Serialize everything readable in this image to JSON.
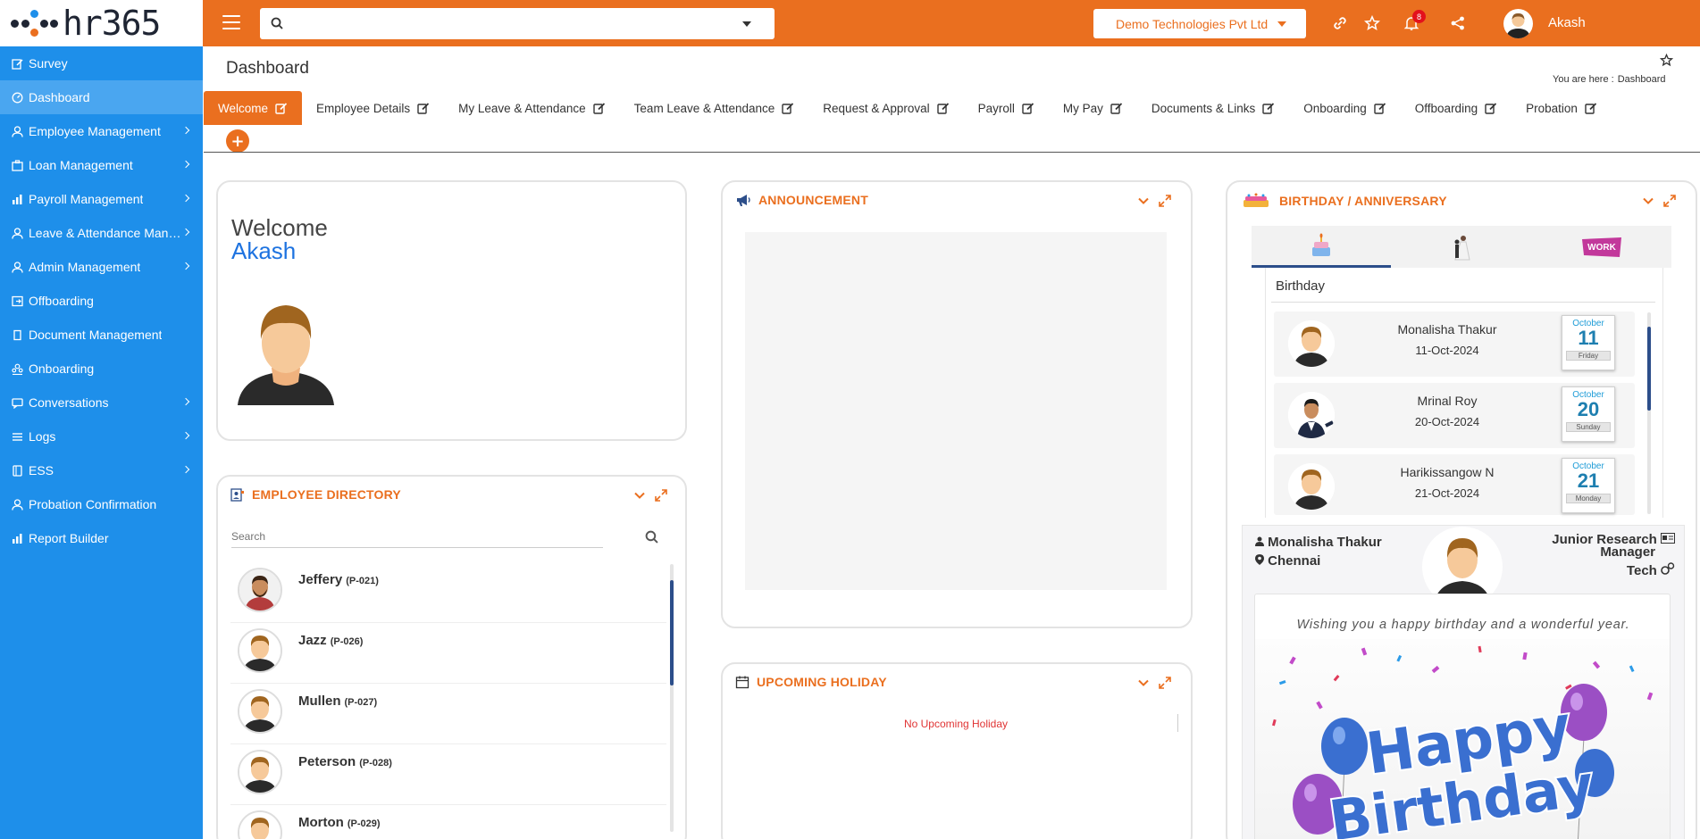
{
  "brand": {
    "logo_text": "hr365",
    "orange": "#ea6f1f",
    "blue": "#1e8fea"
  },
  "topbar": {
    "search_value": "",
    "company": "Demo Technologies Pvt Ltd",
    "notification_count": "8",
    "user_name": "Akash",
    "icons": [
      "link-icon",
      "star-icon",
      "bell-icon",
      "share-icon"
    ]
  },
  "sidebar": {
    "items": [
      {
        "label": "Survey",
        "icon": "edit-icon",
        "has_submenu": false
      },
      {
        "label": "Dashboard",
        "icon": "dashboard-icon",
        "has_submenu": false
      },
      {
        "label": "Employee Management",
        "icon": "user-icon",
        "has_submenu": true
      },
      {
        "label": "Loan Management",
        "icon": "bank-icon",
        "has_submenu": true
      },
      {
        "label": "Payroll Management",
        "icon": "chart-icon",
        "has_submenu": true
      },
      {
        "label": "Leave & Attendance Management",
        "icon": "user-icon",
        "has_submenu": true
      },
      {
        "label": "Admin Management",
        "icon": "user-icon",
        "has_submenu": true
      },
      {
        "label": "Offboarding",
        "icon": "exit-icon",
        "has_submenu": false
      },
      {
        "label": "Document Management",
        "icon": "document-icon",
        "has_submenu": false
      },
      {
        "label": "Onboarding",
        "icon": "team-icon",
        "has_submenu": false
      },
      {
        "label": "Conversations",
        "icon": "chat-icon",
        "has_submenu": true
      },
      {
        "label": "Logs",
        "icon": "list-icon",
        "has_submenu": true
      },
      {
        "label": "ESS",
        "icon": "phone-icon",
        "has_submenu": true
      },
      {
        "label": "Probation Confirmation",
        "icon": "user-icon",
        "has_submenu": false
      },
      {
        "label": "Report Builder",
        "icon": "chart-icon",
        "has_submenu": false
      }
    ]
  },
  "page": {
    "title": "Dashboard",
    "breadcrumb_prefix": "You are here :",
    "breadcrumb_current": "Dashboard"
  },
  "tabs": [
    "Welcome",
    "Employee Details",
    "My Leave & Attendance",
    "Team Leave & Attendance",
    "Request & Approval",
    "Payroll",
    "My Pay",
    "Documents & Links",
    "Onboarding",
    "Offboarding",
    "Probation"
  ],
  "welcome": {
    "greeting": "Welcome",
    "name": "Akash"
  },
  "employee_directory": {
    "title": "EMPLOYEE DIRECTORY",
    "search_placeholder": "Search",
    "employees": [
      {
        "name": "Jeffery",
        "code": "(P-021)"
      },
      {
        "name": "Jazz",
        "code": "(P-026)"
      },
      {
        "name": "Mullen",
        "code": "(P-027)"
      },
      {
        "name": "Peterson",
        "code": "(P-028)"
      },
      {
        "name": "Morton",
        "code": "(P-029)"
      }
    ]
  },
  "announcement": {
    "title": "ANNOUNCEMENT"
  },
  "holiday": {
    "title": "UPCOMING HOLIDAY",
    "empty_text": "No Upcoming Holiday"
  },
  "birthday": {
    "title": "BIRTHDAY / ANNIVERSARY",
    "subheading": "Birthday",
    "tab_icons": [
      "birthday-cake-icon",
      "wedding-icon",
      "work-anniversary-icon"
    ],
    "people": [
      {
        "name": "Monalisha Thakur",
        "date": "11-Oct-2024",
        "month": "October",
        "day": "11",
        "weekday": "Friday"
      },
      {
        "name": "Mrinal Roy",
        "date": "20-Oct-2024",
        "month": "October",
        "day": "20",
        "weekday": "Sunday"
      },
      {
        "name": "Harikissangow N",
        "date": "21-Oct-2024",
        "month": "October",
        "day": "21",
        "weekday": "Monday"
      }
    ],
    "featured": {
      "name": "Monalisha Thakur",
      "location": "Chennai",
      "designation_line1": "Junior Research",
      "designation_line2": "Manager",
      "department": "Tech",
      "wish": "Wishing you a happy birthday and a wonderful year.",
      "banner_line1": "Happy",
      "banner_line2": "Birthday"
    }
  }
}
